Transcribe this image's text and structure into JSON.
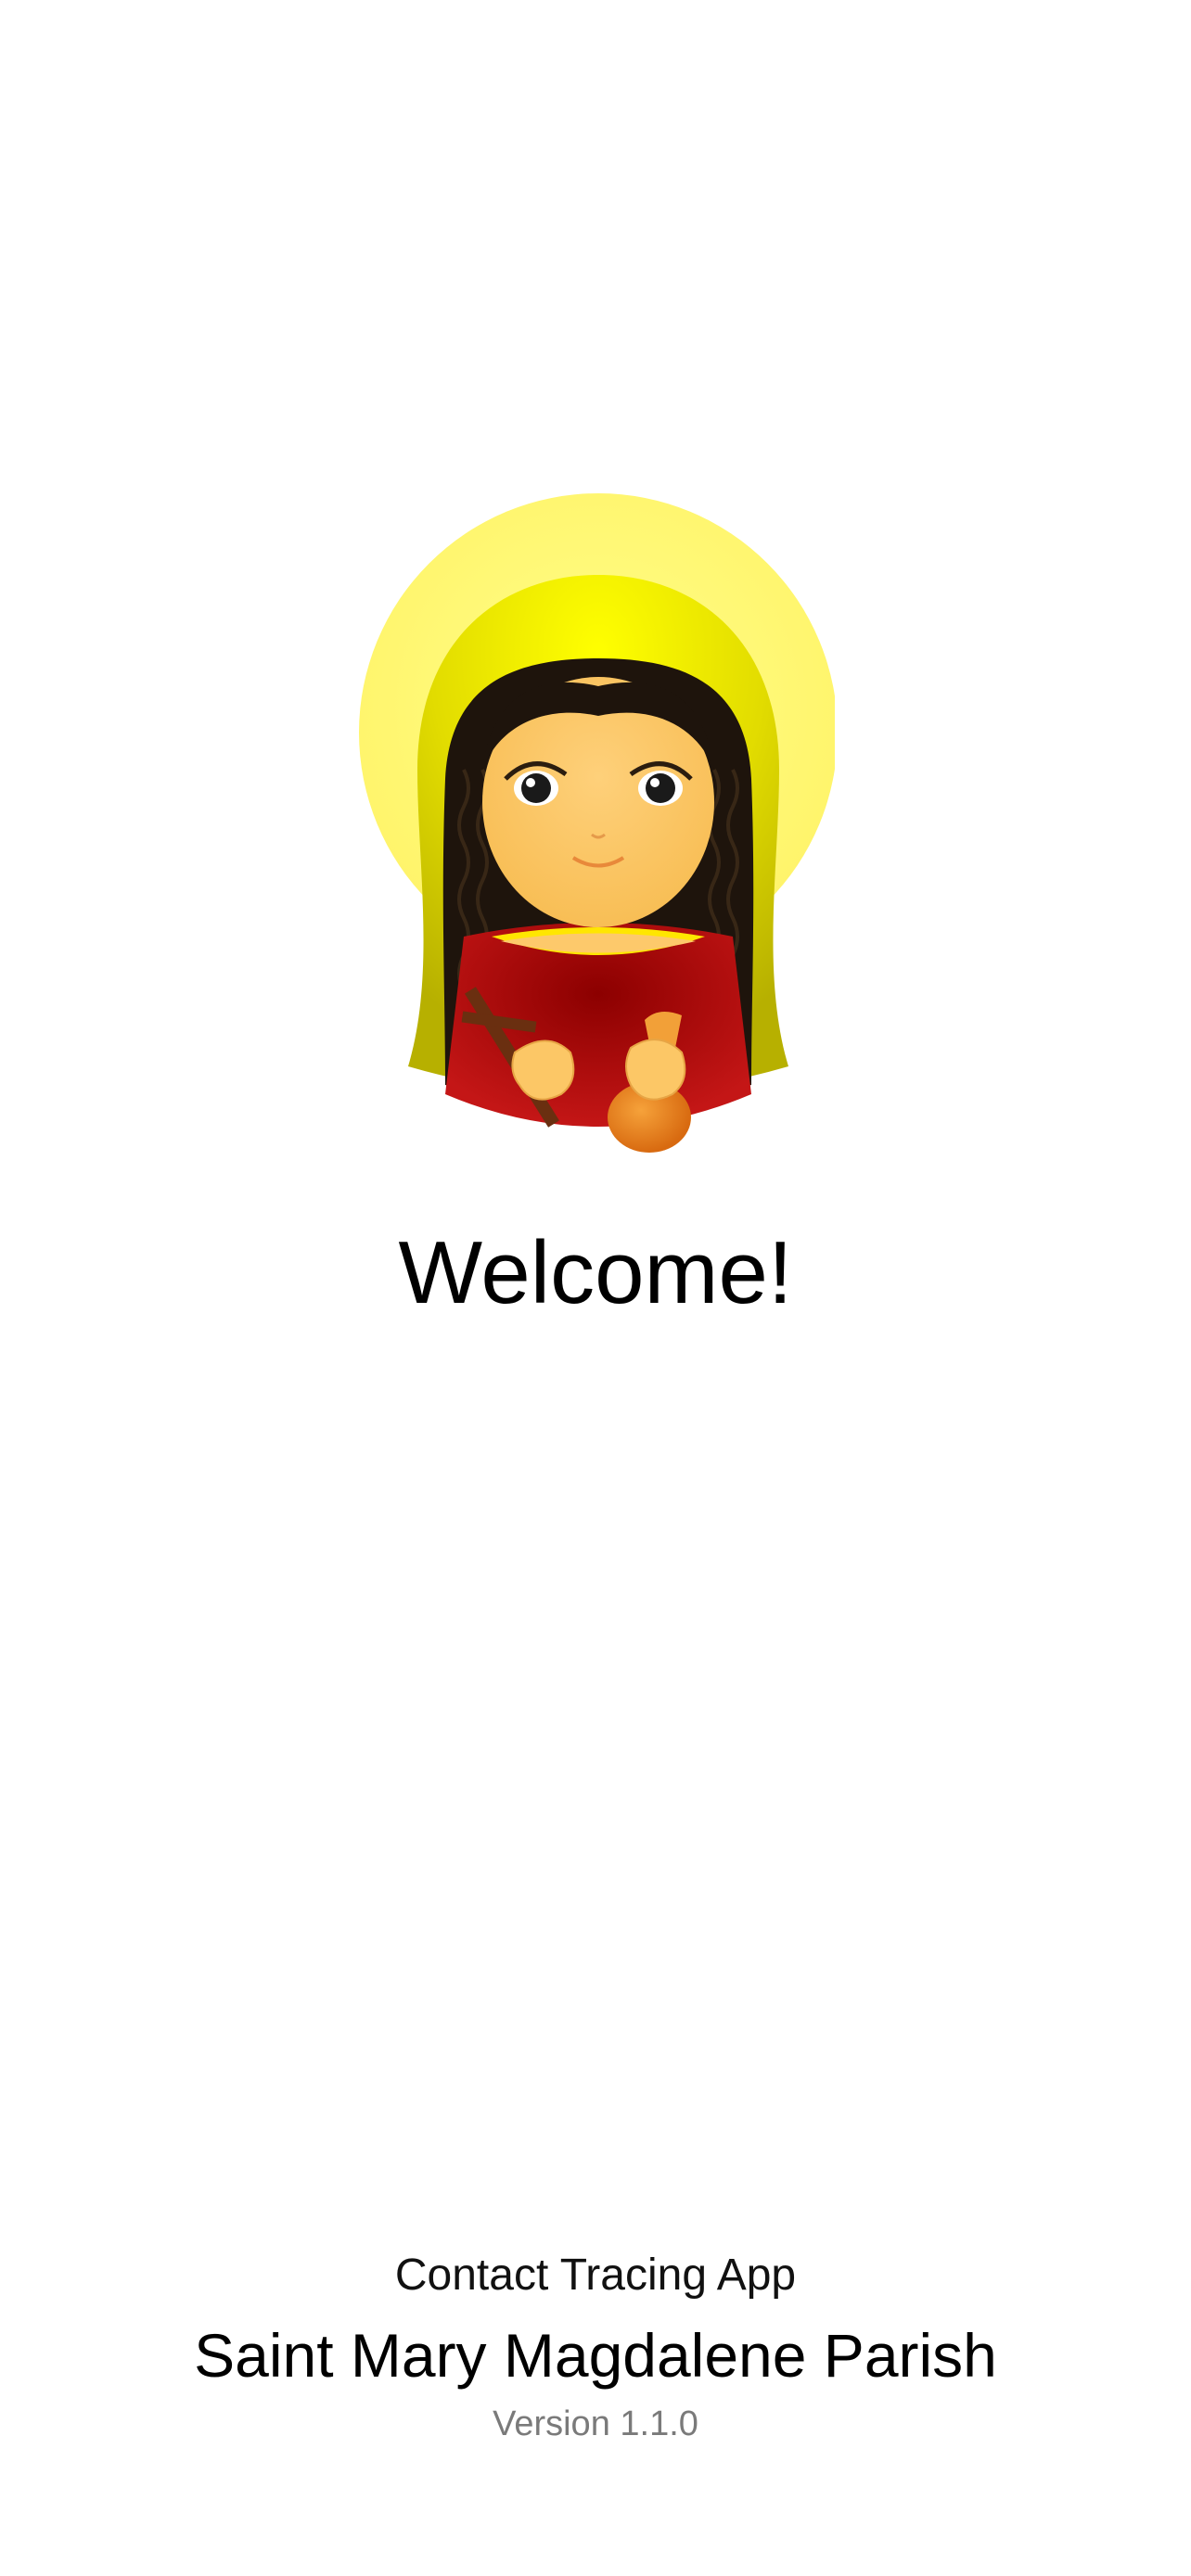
{
  "welcome": {
    "heading": "Welcome!"
  },
  "illustration": {
    "icon": "saint-mary-magdalene-illustration",
    "colors": {
      "halo": "#fff56b",
      "veil": "#d6d000",
      "hair": "#1e140c",
      "skin": "#fdc96b",
      "robe": "#9b0000",
      "cross": "#6a2f10",
      "jar": "#e8851c"
    }
  },
  "footer": {
    "app_name": "Contact Tracing App",
    "parish_name": "Saint Mary Magdalene Parish",
    "version": "Version 1.1.0"
  }
}
